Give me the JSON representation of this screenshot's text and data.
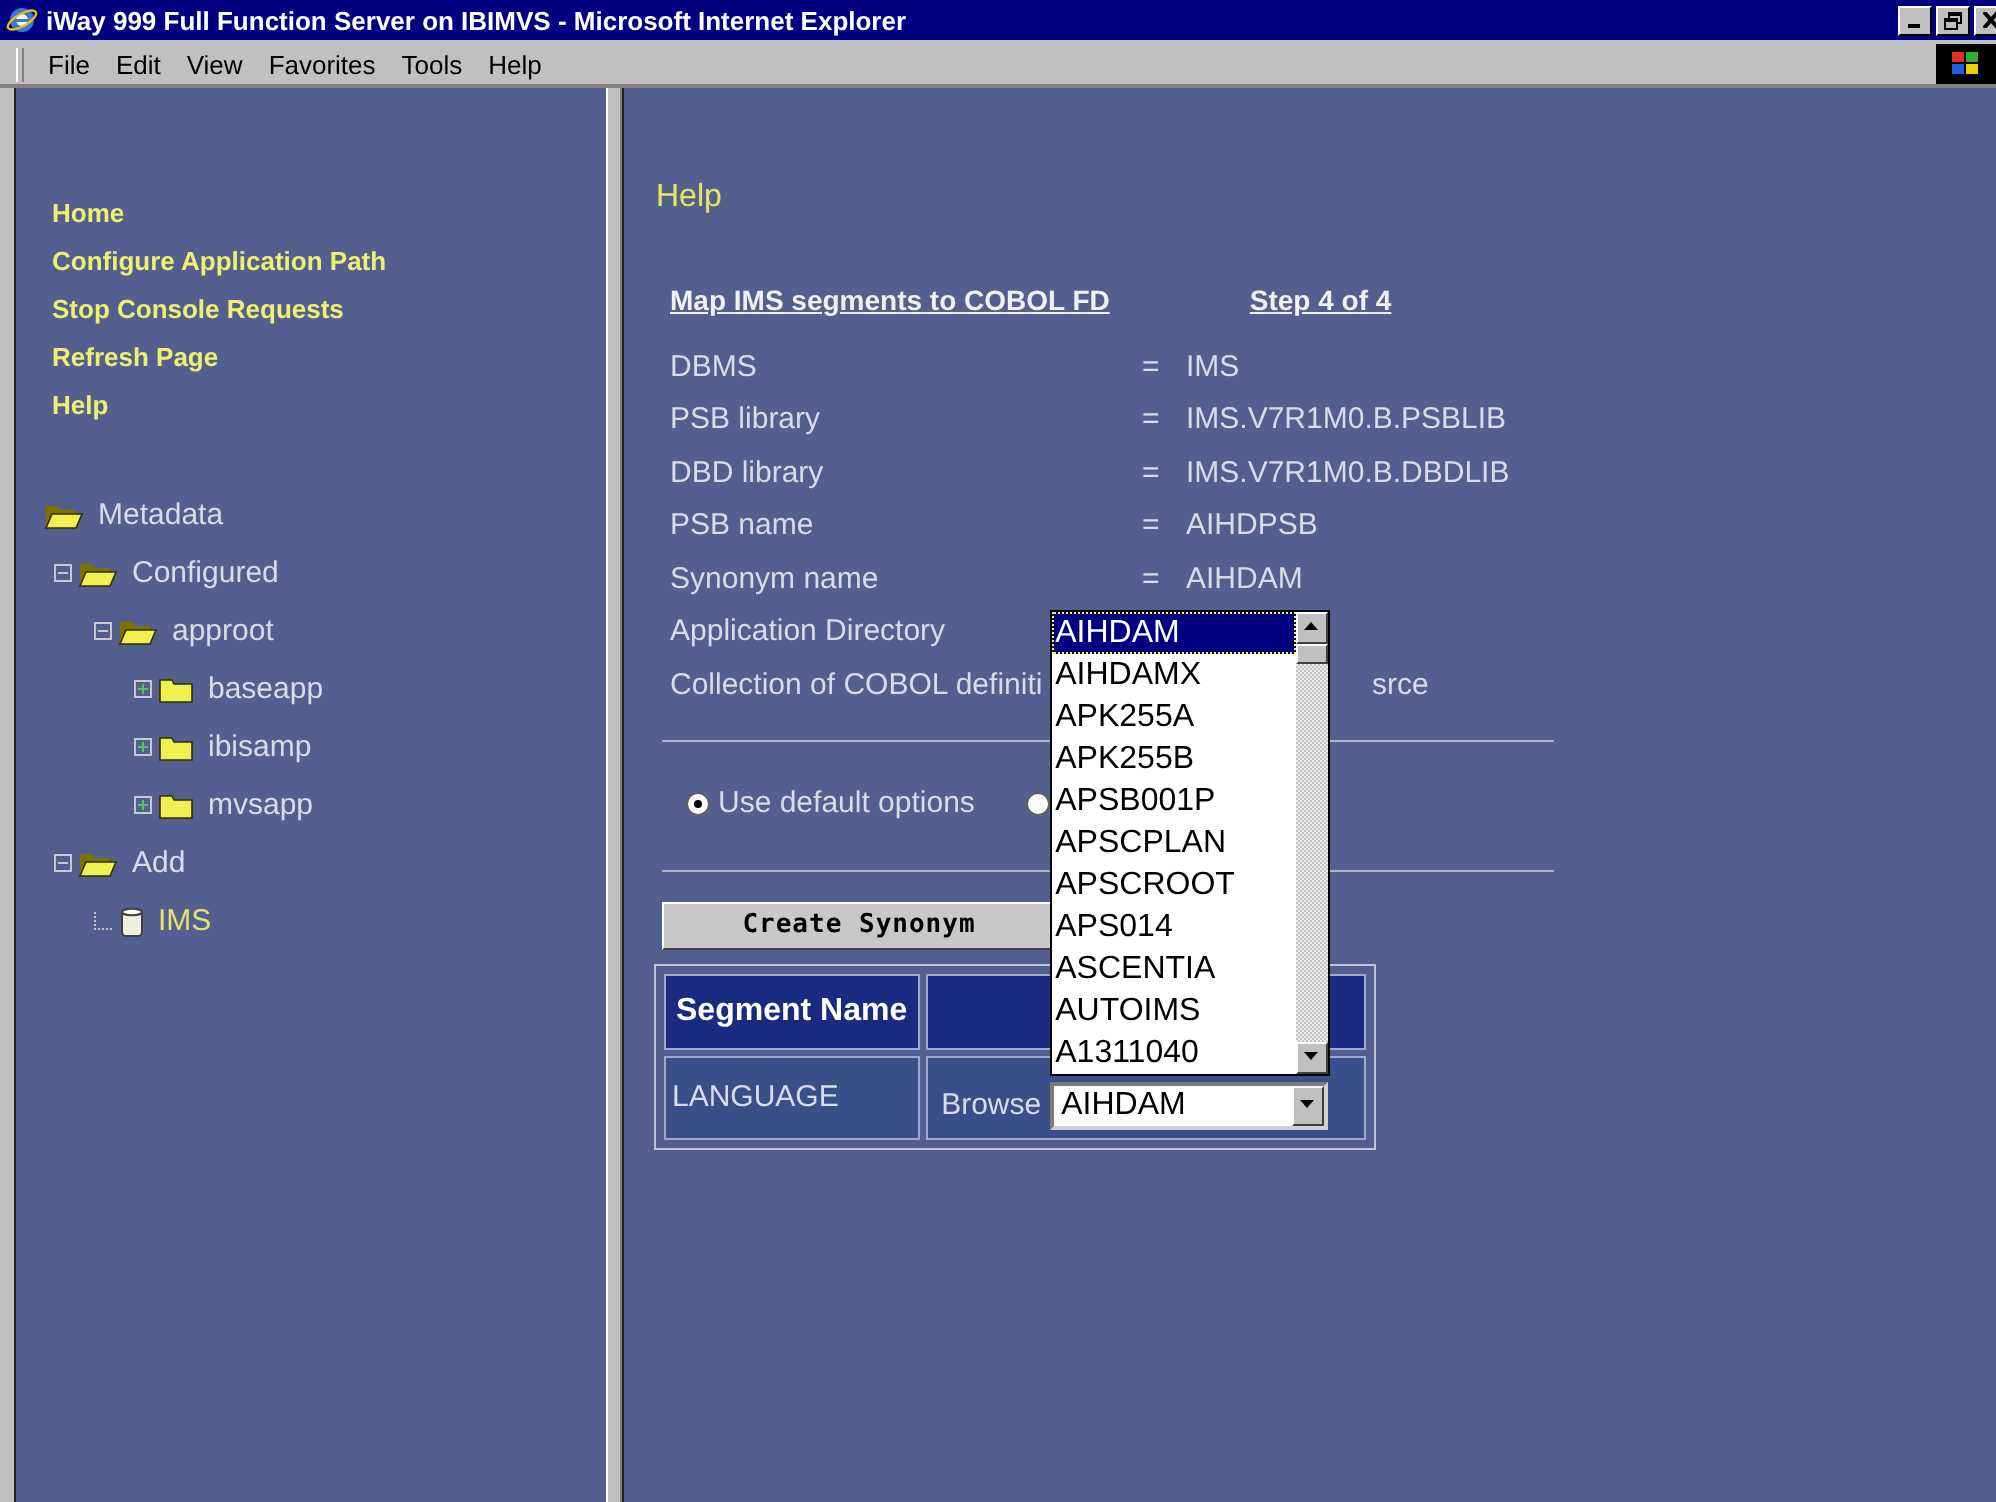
{
  "window": {
    "title": "iWay 999 Full Function Server on IBIMVS - Microsoft Internet Explorer"
  },
  "menu": [
    "File",
    "Edit",
    "View",
    "Favorites",
    "Tools",
    "Help"
  ],
  "nav_links": [
    "Home",
    "Configure Application Path",
    "Stop Console Requests",
    "Refresh Page",
    "Help"
  ],
  "tree": [
    {
      "label": "Metadata",
      "kind": "folder",
      "expanded": true,
      "selected": false,
      "children": [
        {
          "label": "Configured",
          "kind": "folder",
          "expanded": true,
          "selected": false,
          "children": [
            {
              "label": "approot",
              "kind": "folder",
              "expanded": true,
              "selected": false,
              "children": [
                {
                  "label": "baseapp",
                  "kind": "folder",
                  "expanded": false,
                  "selected": false
                },
                {
                  "label": "ibisamp",
                  "kind": "folder",
                  "expanded": false,
                  "selected": false
                },
                {
                  "label": "mvsapp",
                  "kind": "folder",
                  "expanded": false,
                  "selected": false
                }
              ]
            }
          ]
        },
        {
          "label": "Add",
          "kind": "folder",
          "expanded": true,
          "selected": false,
          "children": [
            {
              "label": "IMS",
              "kind": "database",
              "selected": true
            }
          ]
        }
      ]
    }
  ],
  "main": {
    "heading": "Help",
    "title": "Map IMS segments to COBOL FD",
    "step": "Step 4 of 4",
    "fields": [
      {
        "kind": "pair",
        "label": "DBMS",
        "sign": "=",
        "value": "IMS"
      },
      {
        "kind": "pair",
        "label": "PSB library",
        "sign": "=",
        "value": "IMS.V7R1M0.B.PSBLIB"
      },
      {
        "kind": "pair",
        "label": "DBD library",
        "sign": "=",
        "value": "IMS.V7R1M0.B.DBDLIB"
      },
      {
        "kind": "pair",
        "label": "PSB name",
        "sign": "=",
        "value": "AIHDPSB"
      },
      {
        "kind": "pair",
        "label": "Synonym name",
        "sign": "=",
        "value": "AIHDAM"
      },
      {
        "kind": "covered",
        "label": "Application Directory"
      },
      {
        "kind": "covered",
        "label": "Collection of COBOL definiti",
        "value": "srce"
      }
    ],
    "radios": [
      {
        "label": "Use default options",
        "selected": true
      },
      {
        "selected": false
      }
    ],
    "create_button": "Create Synonym",
    "table": {
      "columns": [
        "Segment Name"
      ],
      "rows": [
        {
          "segment": "LANGUAGE",
          "browse": "Browse",
          "value": "AIHDAM",
          "open": true,
          "options": [
            {
              "label": "AIHDAM",
              "selected": true
            },
            {
              "label": "AIHDAMX",
              "selected": false
            },
            {
              "label": "APK255A",
              "selected": false
            },
            {
              "label": "APK255B",
              "selected": false
            },
            {
              "label": "APSB001P",
              "selected": false
            },
            {
              "label": "APSCPLAN",
              "selected": false
            },
            {
              "label": "APSCROOT",
              "selected": false
            },
            {
              "label": "APS014",
              "selected": false
            },
            {
              "label": "ASCENTIA",
              "selected": false
            },
            {
              "label": "AUTOIMS",
              "selected": false
            },
            {
              "label": "A1311040",
              "selected": false
            }
          ]
        }
      ]
    }
  }
}
